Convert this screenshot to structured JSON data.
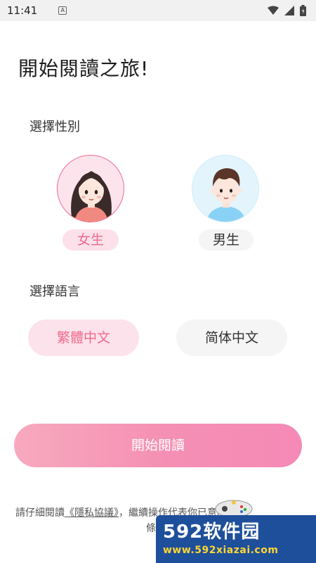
{
  "status_bar": {
    "time": "11:41",
    "notification_glyph": "A",
    "icons": [
      "wifi-icon",
      "signal-icon",
      "battery-icon"
    ]
  },
  "page": {
    "heading": "開始閱讀之旅!",
    "gender_section_label": "選擇性別",
    "gender_options": [
      {
        "label": "女生",
        "selected": true
      },
      {
        "label": "男生",
        "selected": false
      }
    ],
    "language_section_label": "選擇語言",
    "language_options": [
      {
        "label": "繁體中文",
        "selected": true
      },
      {
        "label": "简体中文",
        "selected": false
      }
    ],
    "start_button": "開始閱讀",
    "agreement": {
      "prefix": "請仔細閱讀",
      "link": "《隱私協議》",
      "middle": "，繼續操作代表你已",
      "suffix": "意所有",
      "line2": "條款"
    }
  },
  "watermark": {
    "brand_number": "592",
    "brand_text": "软件园",
    "url": "www.592xiazai.com"
  },
  "colors": {
    "accent_pink": "#f06b8f",
    "selected_bg": "#fce2ea",
    "unselected_bg": "#f5f5f5",
    "button_gradient_start": "#f7a9bf",
    "button_gradient_end": "#f58ab6",
    "watermark_bg": "#1e4f9b"
  }
}
